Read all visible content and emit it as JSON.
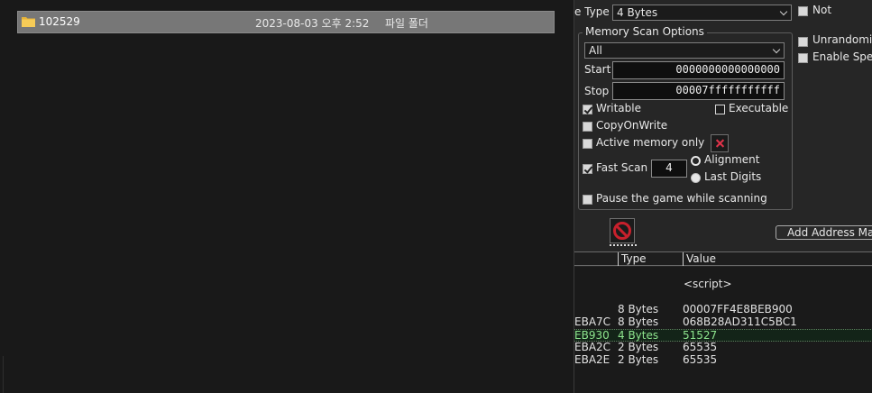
{
  "explorer": {
    "files": [
      {
        "name": "102529",
        "modified": "2023-08-03 오후 2:52",
        "type": "파일 폴더",
        "icon": "folder-icon"
      }
    ]
  },
  "cheat_engine": {
    "value_type": {
      "label": "e Type",
      "selected": "4 Bytes"
    },
    "not_label": "Not",
    "memory_scan": {
      "title": "Memory Scan Options",
      "region": "All",
      "start_label": "Start",
      "start_value": "0000000000000000",
      "stop_label": "Stop",
      "stop_value": "00007fffffffffff",
      "writable_label": "Writable",
      "executable_label": "Executable",
      "copyonwrite_label": "CopyOnWrite",
      "active_memory_label": "Active memory only",
      "fast_scan_label": "Fast Scan",
      "fast_scan_value": "4",
      "alignment_label": "Alignment",
      "last_digits_label": "Last Digits",
      "pause_label": "Pause the game while scanning"
    },
    "unrandomize_label": "Unrandomiz",
    "enable_speedhack_label": "Enable Spe",
    "add_address_label": "Add Address Ma",
    "table": {
      "headers": [
        "Type",
        "Value"
      ],
      "script_value": "<script>",
      "rows": [
        {
          "address": "",
          "type": "8 Bytes",
          "value": "00007FF4E8BEB900"
        },
        {
          "address": "EBA7C",
          "type": "8 Bytes",
          "value": "068B28AD311C5BC1"
        },
        {
          "address": "EB930",
          "type": "4 Bytes",
          "value": "51527"
        },
        {
          "address": "EBA2C",
          "type": "2 Bytes",
          "value": "65535"
        },
        {
          "address": "EBA2E",
          "type": "2 Bytes",
          "value": "65535"
        }
      ]
    }
  },
  "colors": {
    "explorer_bg": "#191919",
    "selected_row": "#777777",
    "ce_bg": "#262626",
    "highlight_text": "#8ee58e",
    "stop_red": "#c8202c"
  }
}
